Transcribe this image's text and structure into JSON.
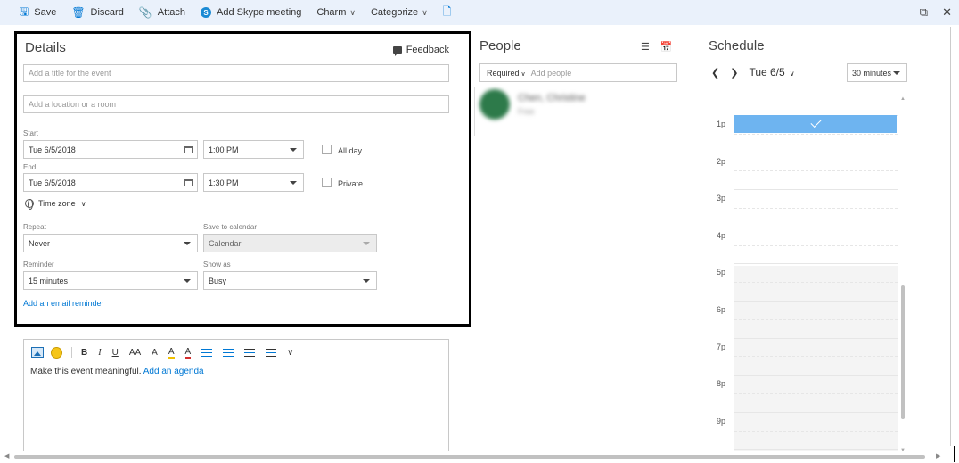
{
  "toolbar": {
    "save": "Save",
    "discard": "Discard",
    "attach": "Attach",
    "skype": "Add Skype meeting",
    "charm": "Charm",
    "categorize": "Categorize"
  },
  "details": {
    "title": "Details",
    "feedback": "Feedback",
    "title_placeholder": "Add a title for the event",
    "location_placeholder": "Add a location or a room",
    "start_label": "Start",
    "start_date": "Tue 6/5/2018",
    "start_time": "1:00 PM",
    "all_day": "All day",
    "end_label": "End",
    "end_date": "Tue 6/5/2018",
    "end_time": "1:30 PM",
    "private": "Private",
    "time_zone": "Time zone",
    "repeat_label": "Repeat",
    "repeat_value": "Never",
    "save_to_label": "Save to calendar",
    "save_to_value": "Calendar",
    "reminder_label": "Reminder",
    "reminder_value": "15 minutes",
    "show_as_label": "Show as",
    "show_as_value": "Busy",
    "email_reminder": "Add an email reminder"
  },
  "editor": {
    "placeholder": "Make this event meaningful.",
    "agenda_link": "Add an agenda",
    "tools": {
      "bold": "B",
      "italic": "I",
      "underline": "U",
      "font_size": "AA",
      "grow": "A",
      "highlight": "A",
      "font_color": "A"
    }
  },
  "people": {
    "title": "People",
    "required": "Required",
    "placeholder": "Add people",
    "attendee_name": "Chen, Christine",
    "attendee_status": "Free"
  },
  "schedule": {
    "title": "Schedule",
    "date": "Tue 6/5",
    "interval": "30 minutes",
    "hours": [
      "1p",
      "2p",
      "3p",
      "4p",
      "5p",
      "6p",
      "7p",
      "8p",
      "9p"
    ]
  },
  "icons": {
    "save": "floppy-disk-icon",
    "discard": "trash-icon",
    "attach": "paperclip-icon",
    "skype": "skype-icon",
    "feedback": "speech-bubble-icon"
  },
  "colors": {
    "accent": "#0078d4",
    "toolbar_bg": "#eaf1fb",
    "event_block": "#6eb4f0",
    "attendee_avatar": "#2d7a4a"
  }
}
